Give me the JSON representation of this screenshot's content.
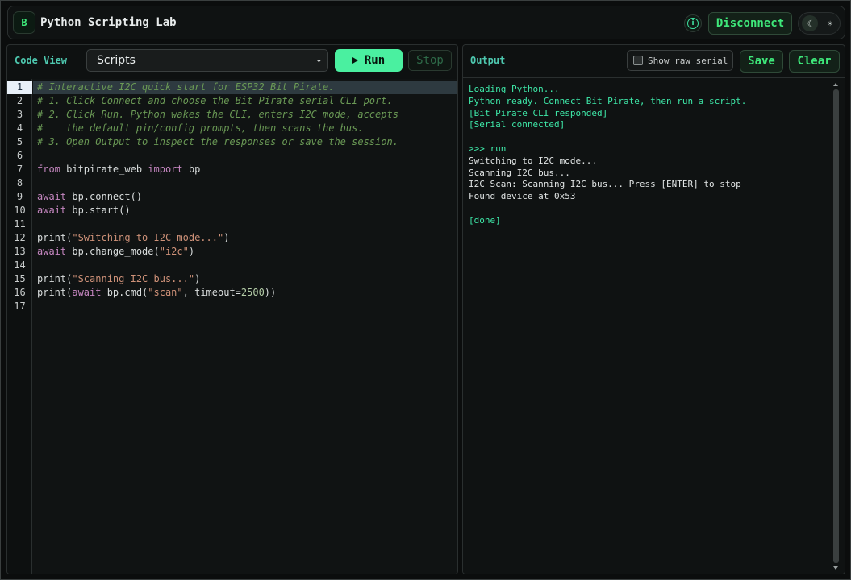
{
  "header": {
    "logo_letter": "B",
    "title": "Python Scripting Lab",
    "info_icon": "info-icon",
    "disconnect_label": "Disconnect",
    "theme_icons": [
      "moon-icon",
      "sun-icon"
    ]
  },
  "editor_panel": {
    "label": "Code View",
    "select_value": "Scripts",
    "run_label": "Run",
    "stop_label": "Stop",
    "active_line": 1,
    "lines": [
      {
        "n": "1",
        "tokens": [
          {
            "t": "comment",
            "v": "# Interactive I2C quick start for ESP32 Bit Pirate."
          }
        ]
      },
      {
        "n": "2",
        "tokens": [
          {
            "t": "comment",
            "v": "# 1. Click Connect and choose the Bit Pirate serial CLI port."
          }
        ]
      },
      {
        "n": "3",
        "tokens": [
          {
            "t": "comment",
            "v": "# 2. Click Run. Python wakes the CLI, enters I2C mode, accepts"
          }
        ]
      },
      {
        "n": "4",
        "tokens": [
          {
            "t": "comment",
            "v": "#    the default pin/config prompts, then scans the bus."
          }
        ]
      },
      {
        "n": "5",
        "tokens": [
          {
            "t": "comment",
            "v": "# 3. Open Output to inspect the responses or save the session."
          }
        ]
      },
      {
        "n": "6",
        "tokens": []
      },
      {
        "n": "7",
        "tokens": [
          {
            "t": "kw",
            "v": "from"
          },
          {
            "t": "plain",
            "v": " bitpirate_web "
          },
          {
            "t": "kw",
            "v": "import"
          },
          {
            "t": "plain",
            "v": " bp"
          }
        ]
      },
      {
        "n": "8",
        "tokens": []
      },
      {
        "n": "9",
        "tokens": [
          {
            "t": "kw",
            "v": "await"
          },
          {
            "t": "plain",
            "v": " bp.connect()"
          }
        ]
      },
      {
        "n": "10",
        "tokens": [
          {
            "t": "kw",
            "v": "await"
          },
          {
            "t": "plain",
            "v": " bp.start()"
          }
        ]
      },
      {
        "n": "11",
        "tokens": []
      },
      {
        "n": "12",
        "tokens": [
          {
            "t": "plain",
            "v": "print("
          },
          {
            "t": "str",
            "v": "\"Switching to I2C mode...\""
          },
          {
            "t": "plain",
            "v": ")"
          }
        ]
      },
      {
        "n": "13",
        "tokens": [
          {
            "t": "kw",
            "v": "await"
          },
          {
            "t": "plain",
            "v": " bp.change_mode("
          },
          {
            "t": "str",
            "v": "\"i2c\""
          },
          {
            "t": "plain",
            "v": ")"
          }
        ]
      },
      {
        "n": "14",
        "tokens": []
      },
      {
        "n": "15",
        "tokens": [
          {
            "t": "plain",
            "v": "print("
          },
          {
            "t": "str",
            "v": "\"Scanning I2C bus...\""
          },
          {
            "t": "plain",
            "v": ")"
          }
        ]
      },
      {
        "n": "16",
        "tokens": [
          {
            "t": "plain",
            "v": "print("
          },
          {
            "t": "kw",
            "v": "await"
          },
          {
            "t": "plain",
            "v": " bp.cmd("
          },
          {
            "t": "str",
            "v": "\"scan\""
          },
          {
            "t": "plain",
            "v": ", timeout="
          },
          {
            "t": "num",
            "v": "2500"
          },
          {
            "t": "plain",
            "v": "))"
          }
        ]
      },
      {
        "n": "17",
        "tokens": []
      }
    ]
  },
  "output_panel": {
    "label": "Output",
    "raw_serial_label": "Show raw serial",
    "raw_serial_checked": false,
    "save_label": "Save",
    "clear_label": "Clear",
    "lines": [
      {
        "text": "Loading Python...",
        "color": "green"
      },
      {
        "text": "Python ready. Connect Bit Pirate, then run a script.",
        "color": "green"
      },
      {
        "text": "[Bit Pirate CLI responded]",
        "color": "green"
      },
      {
        "text": "[Serial connected]",
        "color": "green"
      },
      {
        "text": "",
        "color": "white"
      },
      {
        "text": ">>> run",
        "color": "green"
      },
      {
        "text": "Switching to I2C mode...",
        "color": "white"
      },
      {
        "text": "Scanning I2C bus...",
        "color": "white"
      },
      {
        "text": "I2C Scan: Scanning I2C bus... Press [ENTER] to stop",
        "color": "white"
      },
      {
        "text": "Found device at 0x53",
        "color": "white"
      },
      {
        "text": "",
        "color": "white"
      },
      {
        "text": "[done]",
        "color": "green"
      }
    ]
  },
  "colors": {
    "accent_green": "#3ee87a",
    "teal_label": "#4ec9b0",
    "run_button": "#4af0a0",
    "comment": "#6a9955",
    "keyword": "#c586c0",
    "string": "#ce9178",
    "number": "#b5cea8"
  }
}
